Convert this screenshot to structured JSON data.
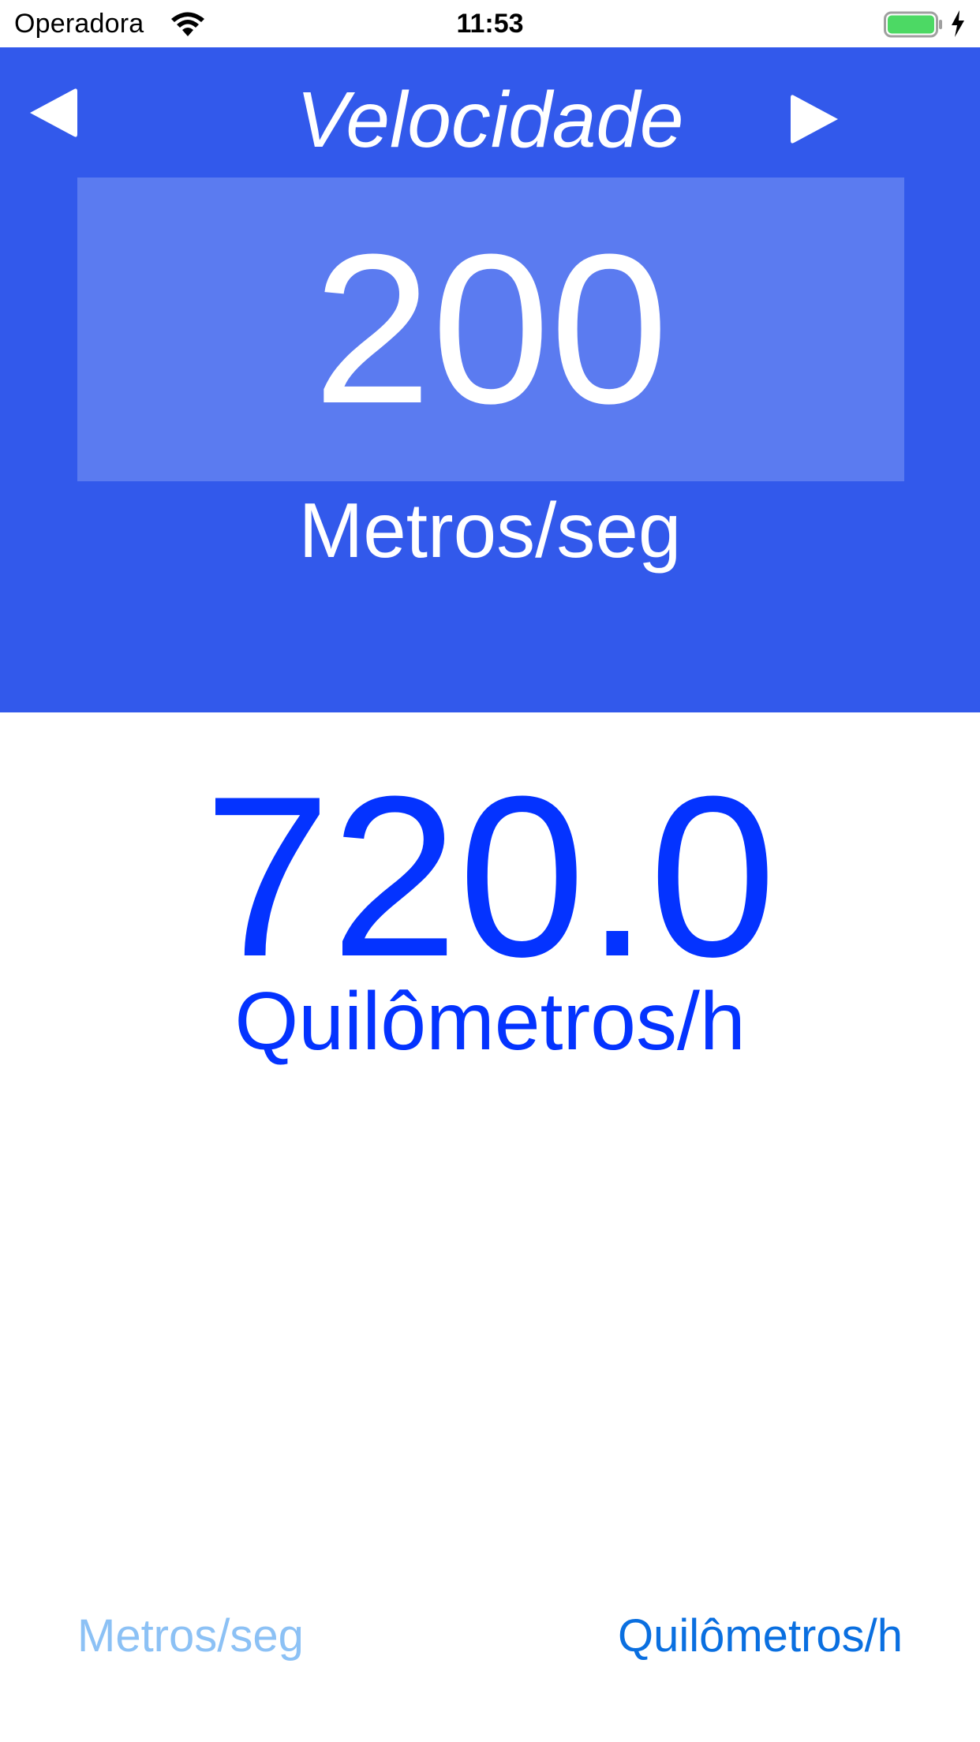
{
  "status_bar": {
    "carrier": "Operadora",
    "time": "11:53",
    "battery_color": "#4cd964"
  },
  "header": {
    "title": "Velocidade",
    "prev_icon": "triangle-left-icon",
    "next_icon": "triangle-right-icon",
    "background": "#3259eb"
  },
  "input": {
    "value": "200",
    "unit": "Metros/seg"
  },
  "result": {
    "value": "720.0",
    "unit": "Quilômetros/h",
    "color": "#0433ff"
  },
  "unit_selector": {
    "from_label": "Metros/seg",
    "to_label": "Quilômetros/h"
  }
}
